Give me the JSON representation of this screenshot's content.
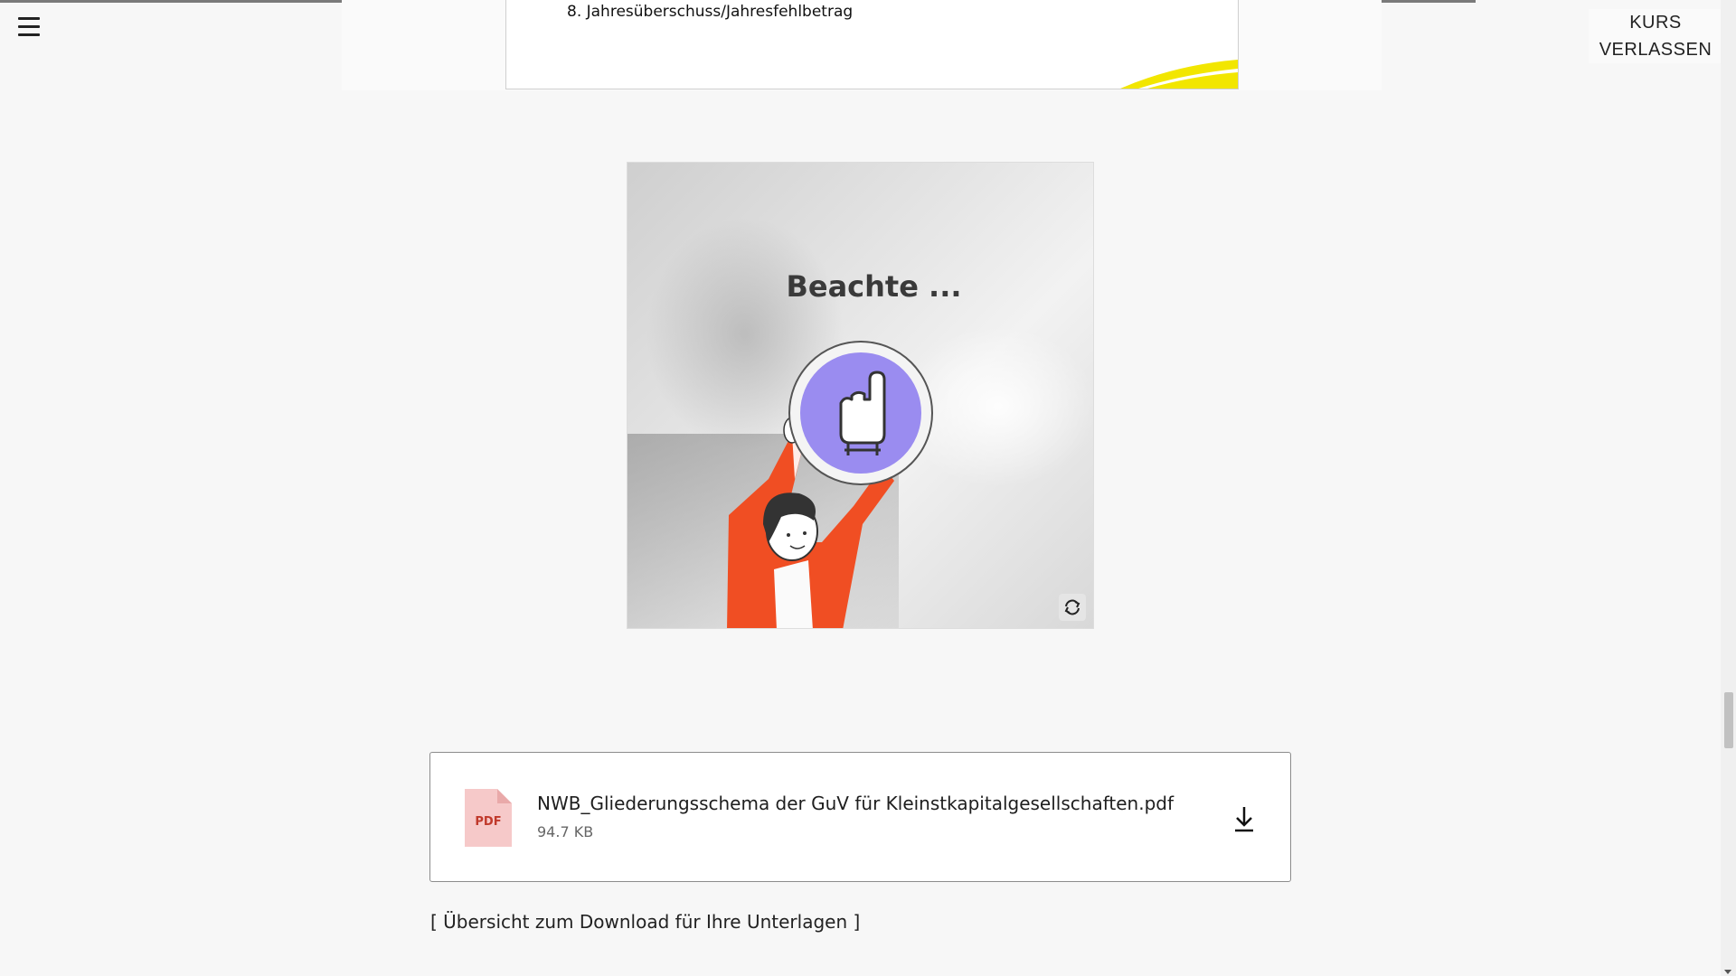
{
  "header": {
    "menu_icon": "hamburger-menu-icon",
    "exit_label_line1": "KURS",
    "exit_label_line2": "VERLASSEN"
  },
  "slide": {
    "item_text": "8. Jahresüberschuss/Jahresfehlbetrag"
  },
  "flip_card": {
    "title": "Beachte ...",
    "flip_icon": "flip-refresh-icon"
  },
  "attachment": {
    "file_type": "PDF",
    "file_name": "NWB_Gliederungsschema der GuV für Kleinstkapitalgesellschaften.pdf",
    "file_size": "94.7 KB",
    "download_icon": "download-icon"
  },
  "footer_link": {
    "text": "[ Übersicht zum Download für Ihre Unterlagen ]"
  },
  "colors": {
    "accent_purple": "#9a8cf0",
    "figure_orange": "#f04e23",
    "brand_yellow": "#f2e600",
    "pdf_pink": "#f6c9c9"
  }
}
